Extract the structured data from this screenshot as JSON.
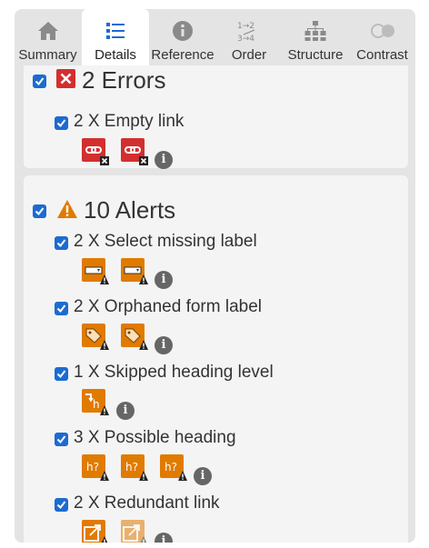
{
  "tabs": [
    {
      "id": "summary",
      "label": "Summary",
      "icon": "home-icon",
      "active": false
    },
    {
      "id": "details",
      "label": "Details",
      "icon": "list-icon",
      "active": true
    },
    {
      "id": "reference",
      "label": "Reference",
      "icon": "info-icon",
      "active": false
    },
    {
      "id": "order",
      "label": "Order",
      "icon": "order-icon",
      "active": false
    },
    {
      "id": "structure",
      "label": "Structure",
      "icon": "structure-icon",
      "active": false
    },
    {
      "id": "contrast",
      "label": "Contrast",
      "icon": "contrast-icon",
      "active": false
    }
  ],
  "categories": {
    "errors": {
      "title": "2 Errors",
      "icon": "error-icon",
      "checked": true,
      "items": [
        {
          "label": "2 X Empty link",
          "checked": true,
          "icon": "empty-link-icon",
          "count": 2
        }
      ]
    },
    "alerts": {
      "title": "10 Alerts",
      "icon": "alert-icon",
      "checked": true,
      "items": [
        {
          "label": "2 X Select missing label",
          "checked": true,
          "icon": "select-missing-label-icon",
          "count": 2
        },
        {
          "label": "2 X Orphaned form label",
          "checked": true,
          "icon": "orphaned-label-icon",
          "count": 2
        },
        {
          "label": "1 X Skipped heading level",
          "checked": true,
          "icon": "skipped-heading-icon",
          "count": 1
        },
        {
          "label": "3 X Possible heading",
          "checked": true,
          "icon": "possible-heading-icon",
          "count": 3
        },
        {
          "label": "2 X Redundant link",
          "checked": true,
          "icon": "redundant-link-icon",
          "count": 2
        }
      ]
    }
  },
  "colors": {
    "panel_bg": "#e4e4e4",
    "card_bg": "#f4f4f4",
    "checkbox": "#1c6bd1",
    "error_red": "#d32f2f",
    "alert_orange": "#e07b00"
  }
}
